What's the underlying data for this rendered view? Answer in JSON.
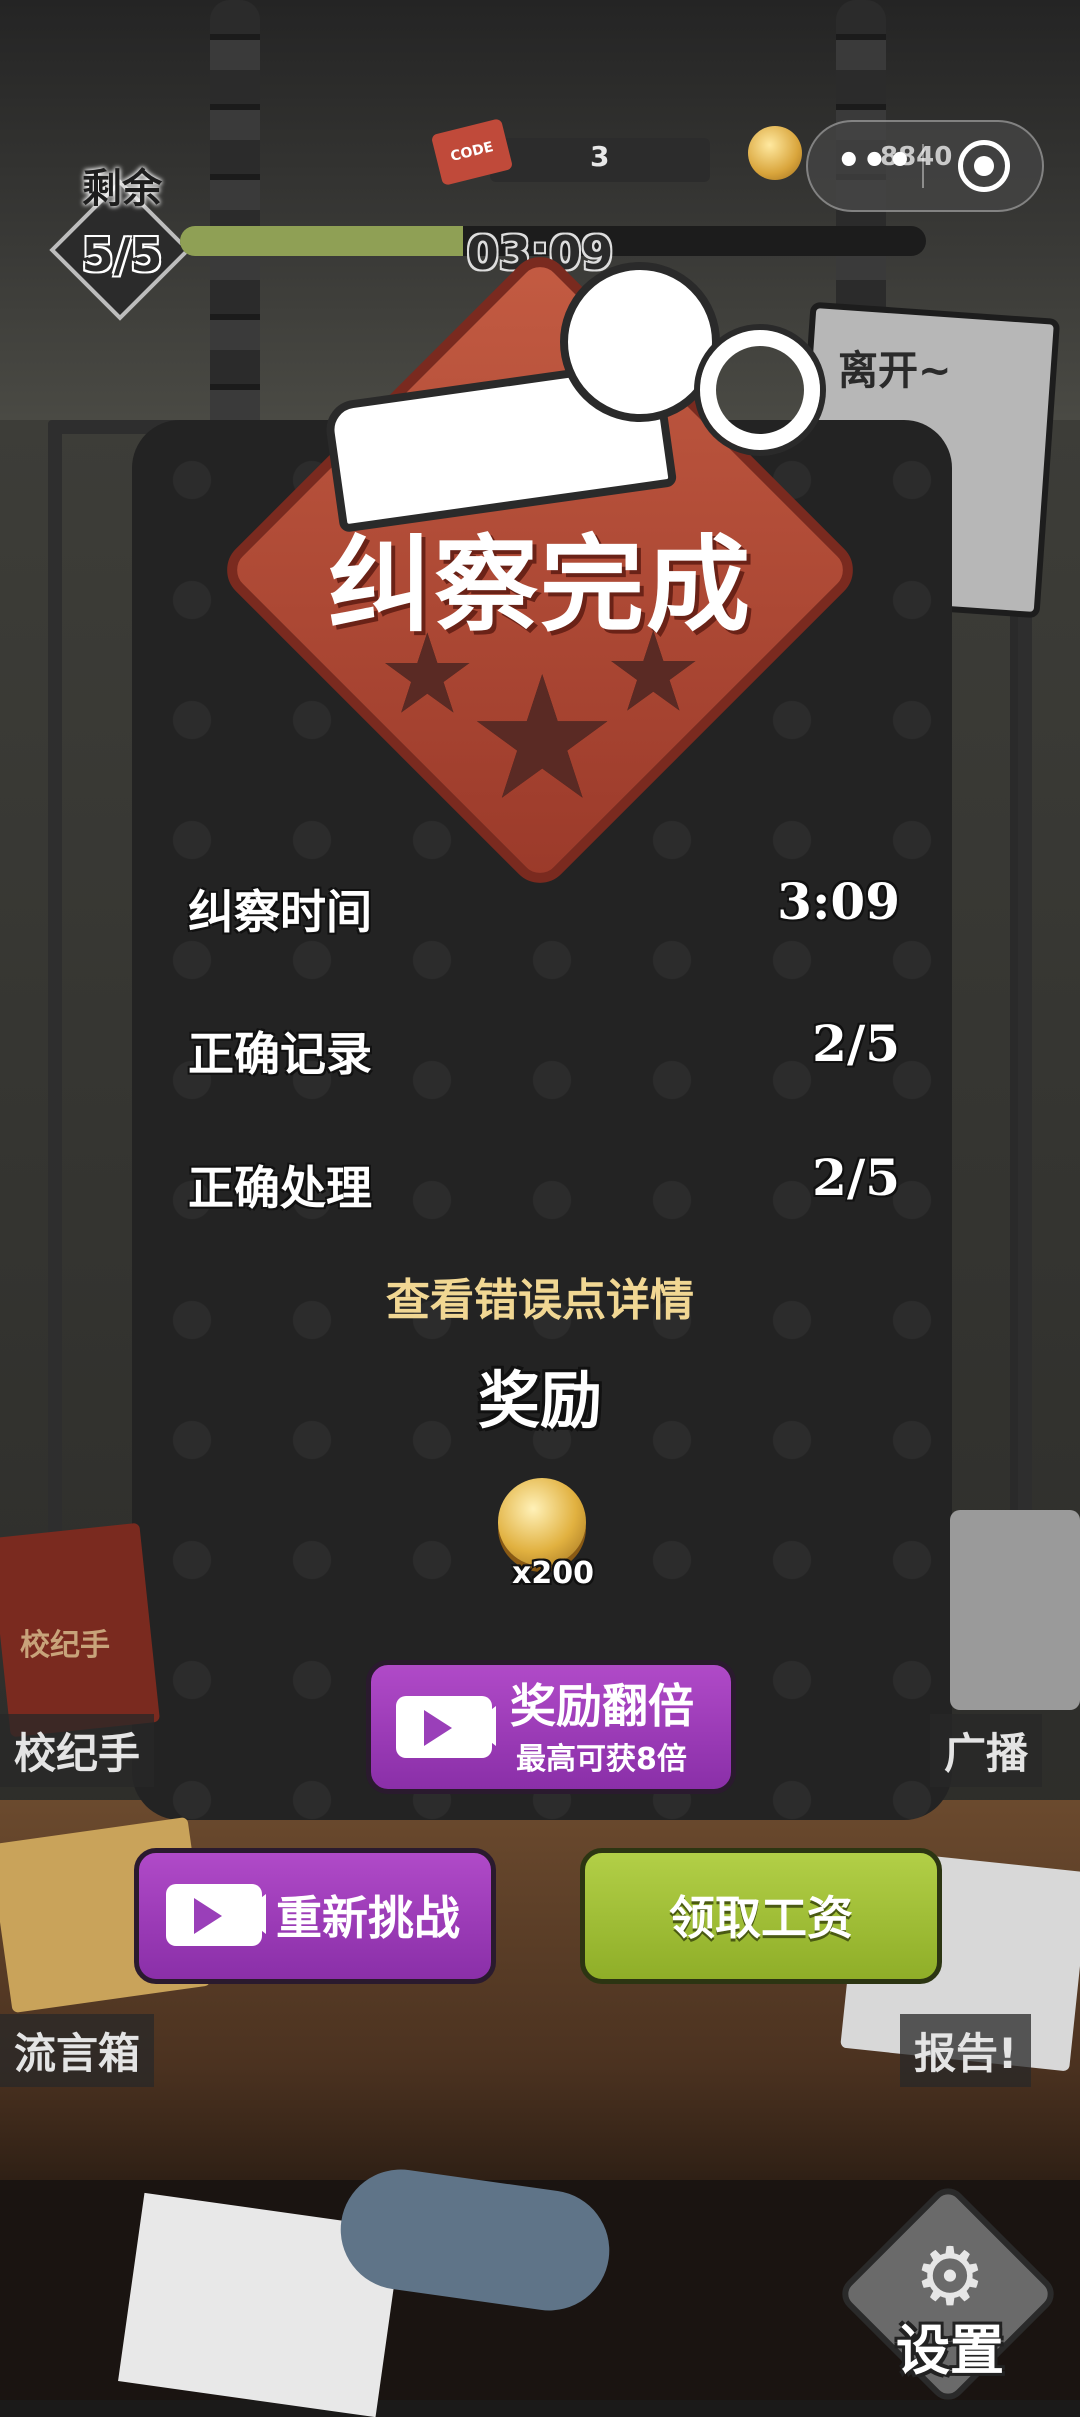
{
  "hud": {
    "remaining_label": "剩余",
    "remaining_count": "5/5",
    "timer": "03:09",
    "progress_fraction": 0.38,
    "code_badge": "CODE",
    "code_count": "3",
    "coins": "8840",
    "capsule_dots": "•••"
  },
  "leave_sign": {
    "label": "离开~"
  },
  "result": {
    "title": "纠察完成",
    "stars_earned": 0,
    "stars_total": 3,
    "stats": [
      {
        "label": "纠察时间",
        "value": "3:09"
      },
      {
        "label": "正确记录",
        "value": "2/5"
      },
      {
        "label": "正确处理",
        "value": "2/5"
      }
    ],
    "error_link": "查看错误点详情",
    "reward_title": "奖励",
    "reward_amount": "x200"
  },
  "buttons": {
    "double_label": "奖励翻倍",
    "double_sub": "最高可获8倍",
    "retry_label": "重新挑战",
    "salary_label": "领取工资"
  },
  "shelf": {
    "manual": "校纪手",
    "broadcast": "广播",
    "rumor_box": "流言箱",
    "report": "报告!",
    "manual_book_text": "校纪手"
  },
  "settings": {
    "label": "设置",
    "icon": "⚙"
  },
  "colors": {
    "accent_red": "#c35b42",
    "button_purple": "#9a3fb9",
    "button_green": "#a3c23a",
    "progress_green": "#8fa055",
    "link_gold": "#f1d793"
  }
}
